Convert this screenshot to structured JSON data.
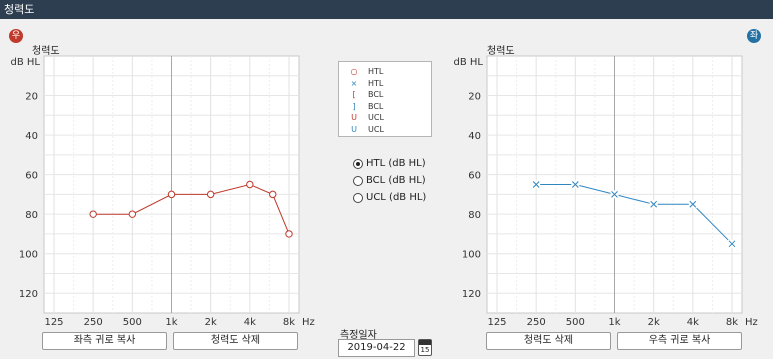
{
  "window": {
    "title": "청력도"
  },
  "ears": {
    "right_badge": "우",
    "left_badge": "좌"
  },
  "legend": [
    {
      "symbol": "○",
      "label": "HTL",
      "color": "#c0392b"
    },
    {
      "symbol": "×",
      "label": "HTL",
      "color": "#2e86c1"
    },
    {
      "symbol": "[",
      "label": "BCL",
      "color": "#c0392b"
    },
    {
      "symbol": "]",
      "label": "BCL",
      "color": "#2e86c1"
    },
    {
      "symbol": "U",
      "label": "UCL",
      "color": "#c0392b"
    },
    {
      "symbol": "U",
      "label": "UCL",
      "color": "#2e86c1"
    }
  ],
  "mode_options": [
    {
      "label": "HTL (dB HL)",
      "selected": true
    },
    {
      "label": "BCL (dB HL)",
      "selected": false
    },
    {
      "label": "UCL (dB HL)",
      "selected": false
    }
  ],
  "date": {
    "label": "측정일자",
    "value": "2019-04-22",
    "calendar_day": "15"
  },
  "buttons": {
    "copy_to_left": "좌측 귀로 복사",
    "delete_right": "청력도 삭제",
    "delete_left": "청력도 삭제",
    "copy_to_right": "우측 귀로 복사"
  },
  "chart_data": [
    {
      "type": "line",
      "ear": "right",
      "title": "청력도",
      "ylabel": "dB HL",
      "xunit": "Hz",
      "x_ticks": [
        "125",
        "250",
        "500",
        "1k",
        "2k",
        "4k",
        "8k"
      ],
      "y_ticks": [
        20,
        40,
        60,
        80,
        100,
        120
      ],
      "ylim": [
        0,
        130
      ],
      "y_inverted": true,
      "color": "#c0392b",
      "marker": "circle",
      "series": [
        {
          "x": [
            250,
            500,
            1000,
            2000,
            4000,
            6000,
            8000
          ],
          "y": [
            80,
            80,
            70,
            70,
            65,
            70,
            90
          ]
        }
      ]
    },
    {
      "type": "line",
      "ear": "left",
      "title": "청력도",
      "ylabel": "dB HL",
      "xunit": "Hz",
      "x_ticks": [
        "125",
        "250",
        "500",
        "1k",
        "2k",
        "4k",
        "8k"
      ],
      "y_ticks": [
        20,
        40,
        60,
        80,
        100,
        120
      ],
      "ylim": [
        0,
        130
      ],
      "y_inverted": true,
      "color": "#2e86c1",
      "marker": "cross",
      "series": [
        {
          "x": [
            250,
            500,
            1000,
            2000,
            4000,
            8000
          ],
          "y": [
            65,
            65,
            70,
            75,
            75,
            95
          ]
        }
      ]
    }
  ]
}
